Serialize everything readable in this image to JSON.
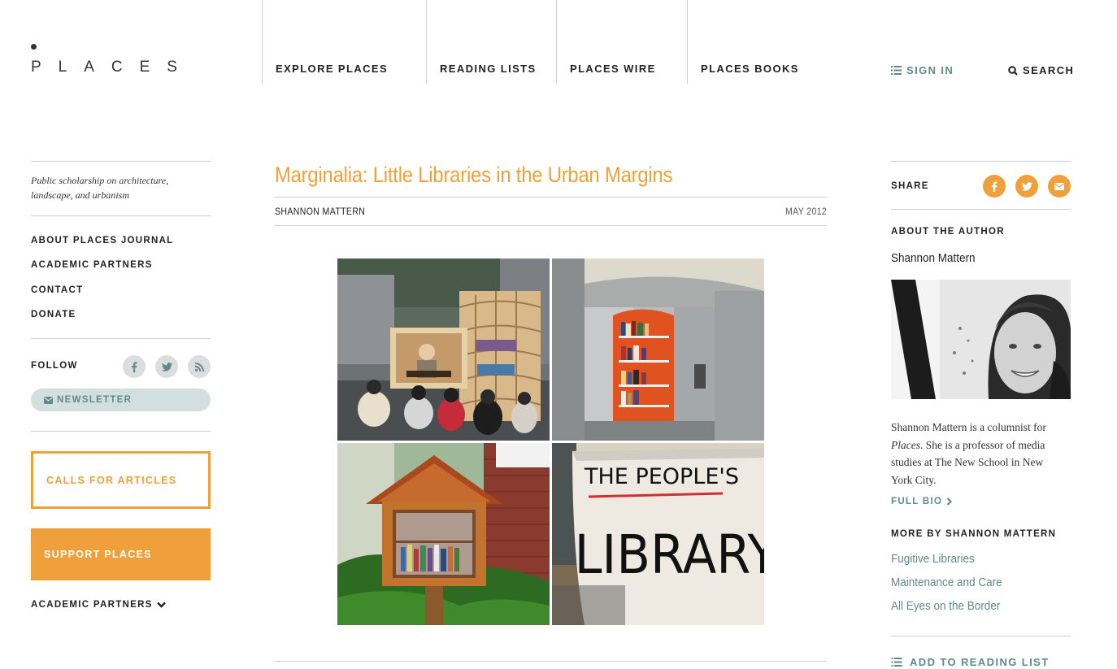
{
  "header": {
    "logo_text": "PLACES",
    "nav": [
      {
        "label": "EXPLORE PLACES"
      },
      {
        "label": "READING LISTS"
      },
      {
        "label": "PLACES WIRE"
      },
      {
        "label": "PLACES BOOKS"
      }
    ],
    "sign_in": "SIGN IN",
    "search": "SEARCH"
  },
  "sidebar": {
    "tagline": "Public scholarship on architecture, landscape, and urbanism",
    "links": [
      {
        "label": "ABOUT PLACES JOURNAL"
      },
      {
        "label": "ACADEMIC PARTNERS"
      },
      {
        "label": "CONTACT"
      },
      {
        "label": "DONATE"
      }
    ],
    "follow_label": "FOLLOW",
    "social_icons": [
      "facebook-icon",
      "twitter-icon",
      "rss-icon"
    ],
    "newsletter": "NEWSLETTER",
    "calls_for_articles": "CALLS FOR ARTICLES",
    "support": "SUPPORT PLACES",
    "academic_partners_toggle": "ACADEMIC PARTNERS"
  },
  "article": {
    "title": "Marginalia: Little Libraries in the Urban Margins",
    "author": "SHANNON MATTERN",
    "date": "MAY 2012",
    "images": [
      "outdoor-library-screening-photo",
      "phone-booth-library-photo",
      "little-free-library-box-photo",
      "peoples-library-sign-photo"
    ],
    "sign_text_line1": "THE PEOPLE'S",
    "sign_text_line2": "LIBRARY"
  },
  "right": {
    "share_label": "SHARE",
    "share_icons": [
      "facebook-icon",
      "twitter-icon",
      "envelope-icon"
    ],
    "about_author_label": "ABOUT THE AUTHOR",
    "author_name": "Shannon Mattern",
    "bio_pre": "Shannon Mattern is a columnist for ",
    "bio_em": "Places",
    "bio_post": ". She is a professor of media studies at The New School in New York City.",
    "full_bio": "FULL BIO",
    "more_by_label": "MORE BY SHANNON MATTERN",
    "more_by": [
      {
        "label": "Fugitive Libraries"
      },
      {
        "label": "Maintenance and Care"
      },
      {
        "label": "All Eyes on the Border"
      }
    ],
    "add_to_reading_list": "ADD TO READING LIST"
  },
  "colors": {
    "accent_orange": "#f0a03a",
    "accent_teal": "#5e8a8c",
    "rule_gray": "#cfcfcf",
    "newsletter_bg": "#d3dfdd"
  }
}
